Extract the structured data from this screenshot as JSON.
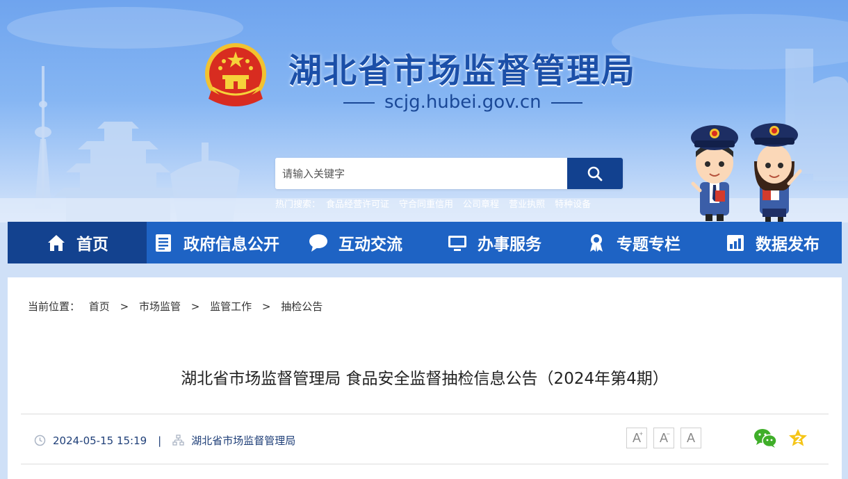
{
  "header": {
    "site_title": "湖北省市场监督管理局",
    "domain": "scjg.hubei.gov.cn"
  },
  "search": {
    "placeholder": "请输入关键字",
    "hot_label": "热门搜索：",
    "hot_terms": [
      "食品经营许可证",
      "守合同重信用",
      "公司章程",
      "营业执照",
      "特种设备"
    ]
  },
  "nav": {
    "items": [
      {
        "label": "首页",
        "icon": "home-icon"
      },
      {
        "label": "政府信息公开",
        "icon": "document-list-icon"
      },
      {
        "label": "互动交流",
        "icon": "chat-bubble-icon"
      },
      {
        "label": "办事服务",
        "icon": "monitor-icon"
      },
      {
        "label": "专题专栏",
        "icon": "award-ribbon-icon"
      },
      {
        "label": "数据发布",
        "icon": "bar-chart-icon"
      }
    ]
  },
  "breadcrumb": {
    "label": "当前位置：",
    "separator": ">",
    "items": [
      "首页",
      "市场监管",
      "监管工作",
      "抽检公告"
    ]
  },
  "article": {
    "title": "湖北省市场监督管理局 食品安全监督抽检信息公告（2024年第4期）",
    "datetime": "2024-05-15 15:19",
    "meta_separator": "|",
    "source": "湖北省市场监督管理局"
  },
  "font_controls": {
    "increase": "A",
    "decrease": "A",
    "reset": "A",
    "plus": "+",
    "minus": "−"
  },
  "colors": {
    "nav_bg": "#1e63c4",
    "nav_active_bg": "#13428f",
    "title_blue": "#1b4fa8",
    "search_button": "#12418f"
  }
}
